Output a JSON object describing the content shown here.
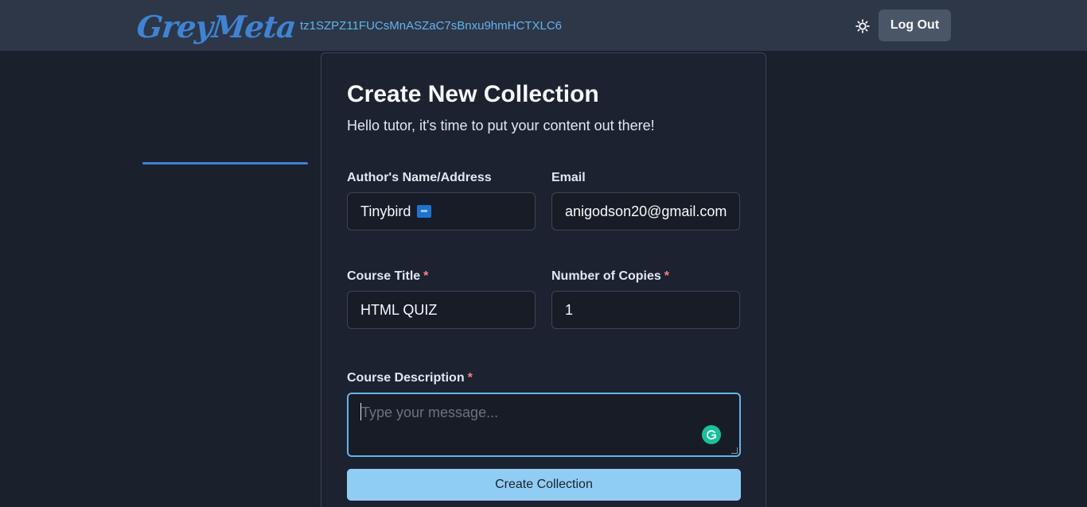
{
  "header": {
    "logo_text": "GreyMeta",
    "wallet_address": "tz1SZPZ11FUCsMnASZaC7sBnxu9hmHCTXLC6",
    "theme_icon": "sun-icon",
    "logout_label": "Log Out"
  },
  "form": {
    "title": "Create New Collection",
    "subtitle": "Hello tutor, it's time to put your content out there!",
    "author": {
      "label": "Author's Name/Address",
      "value": "Tinybird"
    },
    "email": {
      "label": "Email",
      "value": "anigodson20@gmail.com"
    },
    "course_title": {
      "label": "Course Title",
      "required": "*",
      "value": "HTML QUIZ"
    },
    "copies": {
      "label": "Number of Copies",
      "required": "*",
      "value": "1"
    },
    "description": {
      "label": "Course Description",
      "required": "*",
      "placeholder": "Type your message...",
      "value": ""
    },
    "submit_label": "Create Collection"
  },
  "colors": {
    "background": "#1a202c",
    "header": "#2d3748",
    "accent": "#63b3ed",
    "brand": "#3f83d4",
    "button_primary": "#90cdf4",
    "required": "#fc8181"
  }
}
